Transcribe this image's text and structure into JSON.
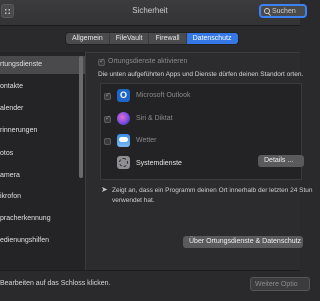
{
  "window": {
    "title": "Sicherheit"
  },
  "search": {
    "placeholder": "Suchen"
  },
  "tabs": [
    {
      "label": "Allgemein"
    },
    {
      "label": "FileVault"
    },
    {
      "label": "Firewall"
    },
    {
      "label": "Datenschutz",
      "active": true
    }
  ],
  "sidebar": {
    "items": [
      {
        "label": "rtungsdienste",
        "selected": true
      },
      {
        "label": "ontakte"
      },
      {
        "label": "alender"
      },
      {
        "label": "rinnerungen"
      },
      {
        "label": "otos"
      },
      {
        "label": "amera"
      },
      {
        "label": "ikrofon"
      },
      {
        "label": "pracherkennung"
      },
      {
        "label": "edienungshilfen"
      }
    ]
  },
  "main": {
    "enable_label": "Ortungsdienste aktivieren",
    "description": "Die unten aufgeführten Apps und Dienste dürfen deinen Standort orten.",
    "apps": [
      {
        "name": "Microsoft Outlook",
        "checked": true,
        "enabled": false,
        "icon": "outlook-icon",
        "color": "#1e66c8"
      },
      {
        "name": "Siri & Diktat",
        "checked": true,
        "enabled": false,
        "icon": "siri-icon",
        "color": "#6d4ce0"
      },
      {
        "name": "Wetter",
        "checked": false,
        "enabled": false,
        "icon": "weather-icon",
        "color": "#3a8ee6"
      },
      {
        "name": "Systemdienste",
        "enabled": true,
        "icon": "gear-icon",
        "color": "#8e8e93"
      }
    ],
    "details_button": "Details ...",
    "arrow_note_line1": "Zeigt an, dass ein Programm deinen Ort innerhalb der letzten 24 Stun",
    "arrow_note_line2": "verwendet hat.",
    "about_button": "Über Ortungsdienste & Datenschutz"
  },
  "bottom": {
    "lock_text": "Bearbeiten auf das Schloss klicken.",
    "more_options": "Weitere Optio"
  },
  "colors": {
    "accent": "#3478e8",
    "background": "#2c2c2e"
  }
}
